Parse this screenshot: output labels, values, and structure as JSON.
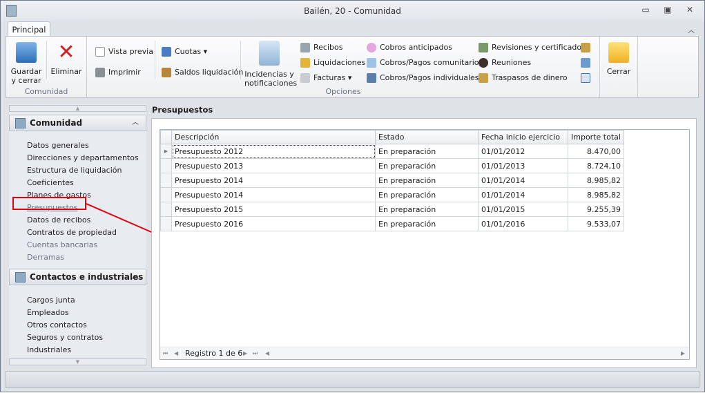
{
  "window": {
    "title": "Bailén, 20 - Comunidad",
    "minimize": "▭",
    "restore": "▣",
    "close": "✕"
  },
  "ribbon": {
    "tab": "Principal",
    "collapse": "︿",
    "groups": {
      "comunidad": "Comunidad",
      "opciones": "Opciones"
    },
    "guardar": "Guardar\ny cerrar",
    "eliminar": "Eliminar",
    "vista_previa": "Vista previa",
    "imprimir": "Imprimir",
    "cuotas": "Cuotas ▾",
    "saldos": "Saldos liquidación",
    "incidencias": "Incidencias y\nnotificaciones",
    "recibos": "Recibos",
    "liquidaciones": "Liquidaciones",
    "facturas": "Facturas ▾",
    "cobros_anticipados": "Cobros anticipados",
    "cobros_comunitarios": "Cobros/Pagos comunitarios",
    "cobros_individuales": "Cobros/Pagos individuales",
    "revisiones": "Revisiones y certificados",
    "reuniones": "Reuniones",
    "traspasos": "Traspasos de dinero",
    "cerrar": "Cerrar"
  },
  "nav": {
    "sections": [
      {
        "title": "Comunidad",
        "items": [
          "Datos generales",
          "Direcciones y departamentos",
          "Estructura de liquidación",
          "Coeficientes",
          "Planes de gastos",
          "Presupuestos",
          "Datos de recibos",
          "Contratos de propiedad",
          "Cuentas bancarias",
          "Derramas"
        ]
      },
      {
        "title": "Contactos e industriales",
        "items": [
          "Cargos junta",
          "Empleados",
          "Otros contactos",
          "Seguros y contratos",
          "Industriales"
        ]
      }
    ],
    "selected": "Presupuestos"
  },
  "content": {
    "title": "Presupuestos",
    "columns": [
      "Descripción",
      "Estado",
      "Fecha inicio ejercicio",
      "Importe total"
    ],
    "rows": [
      [
        "Presupuesto 2012",
        "En preparación",
        "01/01/2012",
        "8.470,00"
      ],
      [
        "Presupuesto 2013",
        "En preparación",
        "01/01/2013",
        "8.724,10"
      ],
      [
        "Presupuesto 2014",
        "En preparación",
        "01/01/2014",
        "8.985,82"
      ],
      [
        "Presupuesto 2014",
        "En preparación",
        "01/01/2014",
        "8.985,82"
      ],
      [
        "Presupuesto 2015",
        "En preparación",
        "01/01/2015",
        "9.255,39"
      ],
      [
        "Presupuesto 2016",
        "En preparación",
        "01/01/2016",
        "9.533,07"
      ]
    ],
    "pager": "Registro 1 de 6"
  },
  "colors": {
    "annotation": "#e3000f"
  }
}
